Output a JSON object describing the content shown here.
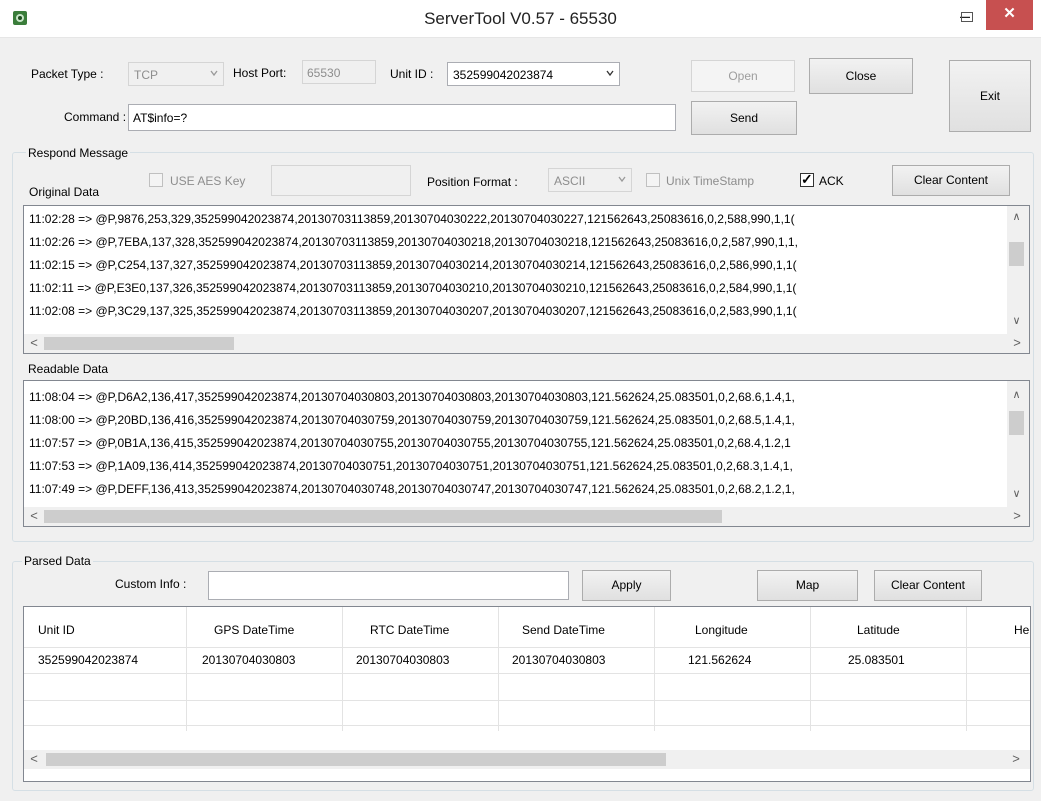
{
  "window": {
    "title": "ServerTool V0.57 - 65530",
    "minimize": "–",
    "close": "✕"
  },
  "top": {
    "packet_type_label": "Packet Type :",
    "packet_type_value": "TCP",
    "host_port_label": "Host Port:",
    "host_port_value": "65530",
    "unit_id_label": "Unit ID :",
    "unit_id_value": "352599042023874",
    "command_label": "Command :",
    "command_value": "AT$info=?",
    "open_label": "Open",
    "close_label": "Close",
    "send_label": "Send",
    "exit_label": "Exit"
  },
  "respond": {
    "group_title": "Respond Message",
    "original_data_label": "Original Data",
    "use_aes_label": "USE AES Key",
    "aes_key_value": "",
    "position_format_label": "Position Format :",
    "position_format_value": "ASCII",
    "unix_timestamp_label": "Unix TimeStamp",
    "ack_label": "ACK",
    "ack_checked": true,
    "clear_label": "Clear Content",
    "original_lines": [
      "11:02:28 => @P,9876,253,329,352599042023874,20130703113859,20130704030222,20130704030227,121562643,25083616,0,2,588,990,1,1(",
      "11:02:26 => @P,7EBA,137,328,352599042023874,20130703113859,20130704030218,20130704030218,121562643,25083616,0,2,587,990,1,1,",
      "11:02:15 => @P,C254,137,327,352599042023874,20130703113859,20130704030214,20130704030214,121562643,25083616,0,2,586,990,1,1(",
      "11:02:11 => @P,E3E0,137,326,352599042023874,20130703113859,20130704030210,20130704030210,121562643,25083616,0,2,584,990,1,1(",
      "11:02:08 => @P,3C29,137,325,352599042023874,20130703113859,20130704030207,20130704030207,121562643,25083616,0,2,583,990,1,1("
    ],
    "readable_data_label": "Readable Data",
    "readable_lines": [
      "11:08:04 => @P,D6A2,136,417,352599042023874,20130704030803,20130704030803,20130704030803,121.562624,25.083501,0,2,68.6,1.4,1,",
      "11:08:00 => @P,20BD,136,416,352599042023874,20130704030759,20130704030759,20130704030759,121.562624,25.083501,0,2,68.5,1.4,1,",
      "11:07:57 => @P,0B1A,136,415,352599042023874,20130704030755,20130704030755,20130704030755,121.562624,25.083501,0,2,68.4,1.2,1",
      "11:07:53 => @P,1A09,136,414,352599042023874,20130704030751,20130704030751,20130704030751,121.562624,25.083501,0,2,68.3,1.4,1,",
      "11:07:49 => @P,DEFF,136,413,352599042023874,20130704030748,20130704030747,20130704030747,121.562624,25.083501,0,2,68.2,1.2,1,"
    ]
  },
  "parsed": {
    "group_title": "Parsed Data",
    "custom_info_label": "Custom Info :",
    "custom_info_value": "",
    "apply_label": "Apply",
    "map_label": "Map",
    "clear_label": "Clear Content",
    "columns": [
      "Unit ID",
      "GPS DateTime",
      "RTC DateTime",
      "Send DateTime",
      "Longitude",
      "Latitude",
      "He"
    ],
    "rows": [
      [
        "352599042023874",
        "20130704030803",
        "20130704030803",
        "20130704030803",
        "121.562624",
        "25.083501",
        ""
      ]
    ]
  },
  "scroll": {
    "up": "∧",
    "down": "∨",
    "left": "<",
    "right": ">"
  }
}
